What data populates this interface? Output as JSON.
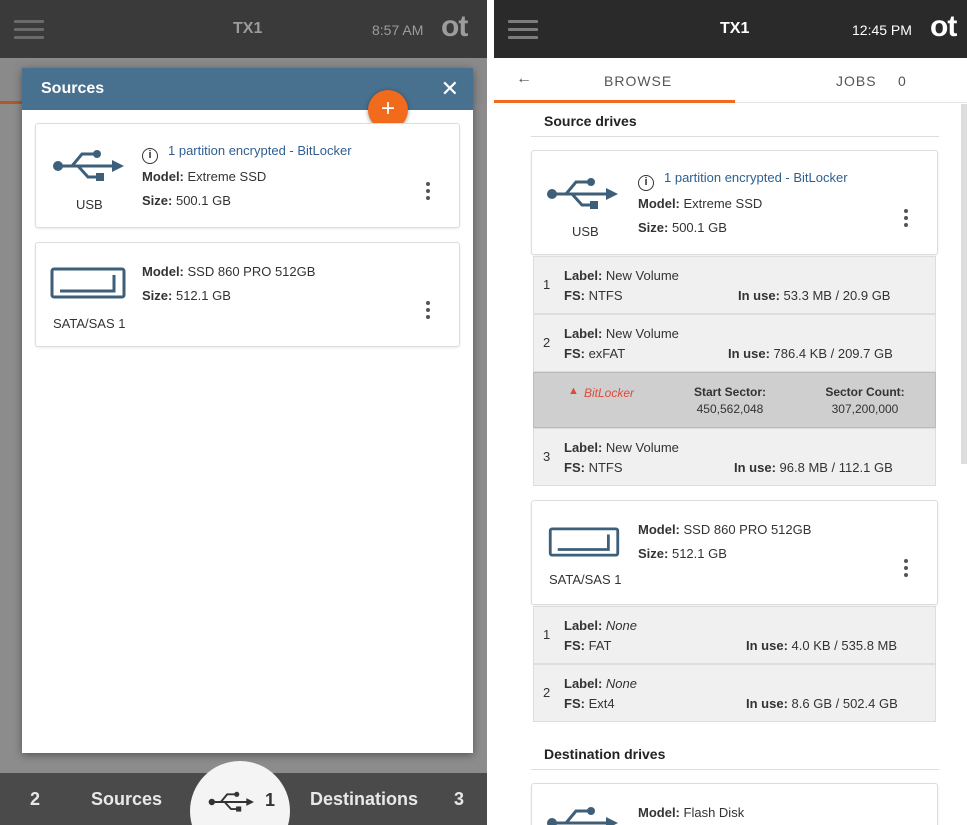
{
  "left": {
    "topbar": {
      "title": "TX1",
      "time": "8:57 AM",
      "logo": "ot"
    },
    "modal": {
      "title": "Sources",
      "close": "✕",
      "add": "+",
      "drives": [
        {
          "type": "USB",
          "info": "1 partition encrypted - BitLocker",
          "model_key": "Model:",
          "model": "Extreme SSD",
          "size_key": "Size:",
          "size": "500.1 GB"
        },
        {
          "type": "SATA/SAS 1",
          "model_key": "Model:",
          "model": "SSD 860 PRO 512GB",
          "size_key": "Size:",
          "size": "512.1 GB"
        }
      ]
    },
    "bottom": {
      "sources_count": "2",
      "sources_label": "Sources",
      "usb_count": "1",
      "destinations_label": "Destinations",
      "destinations_count": "3"
    }
  },
  "right": {
    "topbar": {
      "title": "TX1",
      "time": "12:45 PM",
      "logo": "ot"
    },
    "tabs": {
      "back": "←",
      "browse": "BROWSE",
      "jobs": "JOBS",
      "jobs_count": "0"
    },
    "source_heading": "Source drives",
    "dest_heading": "Destination drives",
    "usb": {
      "type": "USB",
      "info": "1 partition encrypted - BitLocker",
      "model_key": "Model:",
      "model": "Extreme SSD",
      "size_key": "Size:",
      "size": "500.1 GB",
      "partitions": [
        {
          "num": "1",
          "label_key": "Label:",
          "label": "New Volume",
          "fs_key": "FS:",
          "fs": "NTFS",
          "inuse_key": "In use:",
          "inuse": "53.3 MB / 20.9 GB"
        },
        {
          "num": "2",
          "label_key": "Label:",
          "label": "New Volume",
          "fs_key": "FS:",
          "fs": "exFAT",
          "inuse_key": "In use:",
          "inuse": "786.4 KB / 209.7 GB"
        },
        {
          "num": "3",
          "label_key": "Label:",
          "label": "New Volume",
          "fs_key": "FS:",
          "fs": "NTFS",
          "inuse_key": "In use:",
          "inuse": "96.8 MB / 112.1 GB"
        }
      ],
      "encrypted": {
        "warn": "BitLocker",
        "start_key": "Start Sector:",
        "start": "450,562,048",
        "count_key": "Sector Count:",
        "count": "307,200,000"
      }
    },
    "sata": {
      "type": "SATA/SAS 1",
      "model_key": "Model:",
      "model": "SSD 860 PRO 512GB",
      "size_key": "Size:",
      "size": "512.1 GB",
      "partitions": [
        {
          "num": "1",
          "label_key": "Label:",
          "label": "None",
          "fs_key": "FS:",
          "fs": "FAT",
          "inuse_key": "In use:",
          "inuse": "4.0 KB / 535.8 MB"
        },
        {
          "num": "2",
          "label_key": "Label:",
          "label": "None",
          "fs_key": "FS:",
          "fs": "Ext4",
          "inuse_key": "In use:",
          "inuse": "8.6 GB / 502.4 GB"
        }
      ]
    },
    "dest": {
      "model_key": "Model:",
      "model": "Flash Disk"
    }
  },
  "colors": {
    "accent": "#f26b1d",
    "modal_header": "#48708f",
    "info_text": "#2f5f8f",
    "warning": "#e04a3a"
  }
}
